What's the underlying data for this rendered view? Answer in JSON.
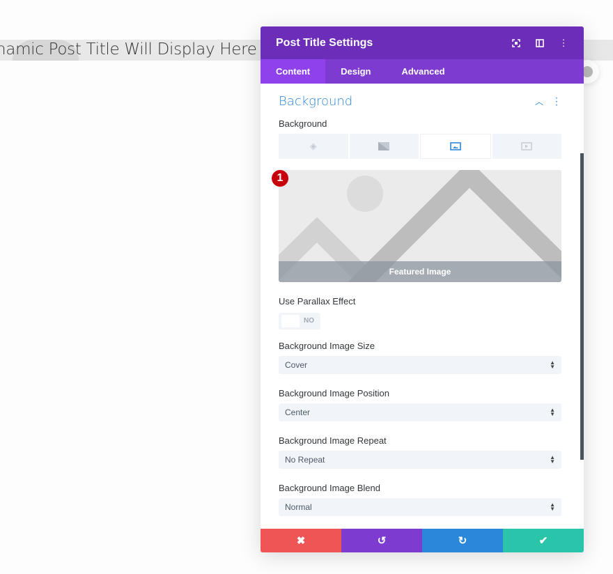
{
  "page": {
    "title": "namic Post Title Will Display Here"
  },
  "modal": {
    "title": "Post Title Settings",
    "header_icons": [
      "fullscreen-icon",
      "split-view-icon",
      "more-icon"
    ],
    "tabs": [
      {
        "label": "Content",
        "active": true
      },
      {
        "label": "Design"
      },
      {
        "label": "Advanced"
      }
    ],
    "section": {
      "title": "Background"
    },
    "background": {
      "label": "Background",
      "types": [
        "color",
        "gradient",
        "image",
        "video"
      ],
      "active_type": "image"
    },
    "image": {
      "caption": "Featured Image",
      "badge": "1"
    },
    "parallax": {
      "label": "Use Parallax Effect",
      "value": "NO"
    },
    "fields": [
      {
        "label": "Background Image Size",
        "value": "Cover"
      },
      {
        "label": "Background Image Position",
        "value": "Center"
      },
      {
        "label": "Background Image Repeat",
        "value": "No Repeat"
      },
      {
        "label": "Background Image Blend",
        "value": "Normal"
      }
    ],
    "footer": {
      "cancel": "✖",
      "undo": "↺",
      "redo": "↻",
      "save": "✔"
    },
    "colors": {
      "header": "#6c2eb9",
      "tabs": "#7e3bd0",
      "accent": "#2b87da",
      "cancel": "#ef5555",
      "undo": "#7e3bd0",
      "redo": "#2b87da",
      "save": "#29c4a9"
    }
  }
}
